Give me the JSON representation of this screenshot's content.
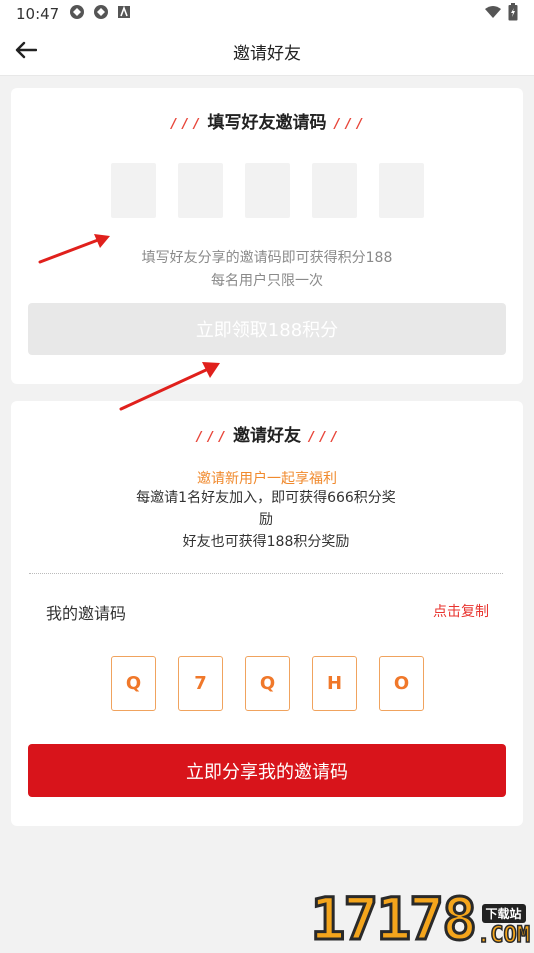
{
  "status_bar": {
    "time": "10:47",
    "icons": [
      "sync-icon",
      "sync-icon",
      "app-icon",
      "wifi-icon",
      "battery-icon"
    ]
  },
  "header": {
    "title": "邀请好友",
    "back_icon": "back-arrow-icon"
  },
  "fill_code_section": {
    "title": "填写好友邀请码",
    "decoration": "/ / /",
    "code_slots": [
      "",
      "",
      "",
      "",
      ""
    ],
    "hint_line1": "填写好友分享的邀请码即可获得积分188",
    "hint_line2": "每名用户只限一次",
    "claim_button": "立即领取188积分"
  },
  "invite_section": {
    "title": "邀请好友",
    "promo_title": "邀请新用户一起享福利",
    "promo_line1": "每邀请1名好友加入，即可获得666积分奖",
    "promo_line2": "励",
    "promo_line3": "好友也可获得188积分奖励",
    "my_code_label": "我的邀请码",
    "copy_label": "点击复制",
    "my_code": [
      "Q",
      "7",
      "Q",
      "H",
      "O"
    ],
    "share_button": "立即分享我的邀请码"
  },
  "watermark": {
    "digits": "17178",
    "tag": "下载站",
    "suffix": ".COM"
  },
  "colors": {
    "accent_red": "#d8141b",
    "accent_orange": "#f08a2e",
    "annotation_arrow": "#e0201c"
  }
}
